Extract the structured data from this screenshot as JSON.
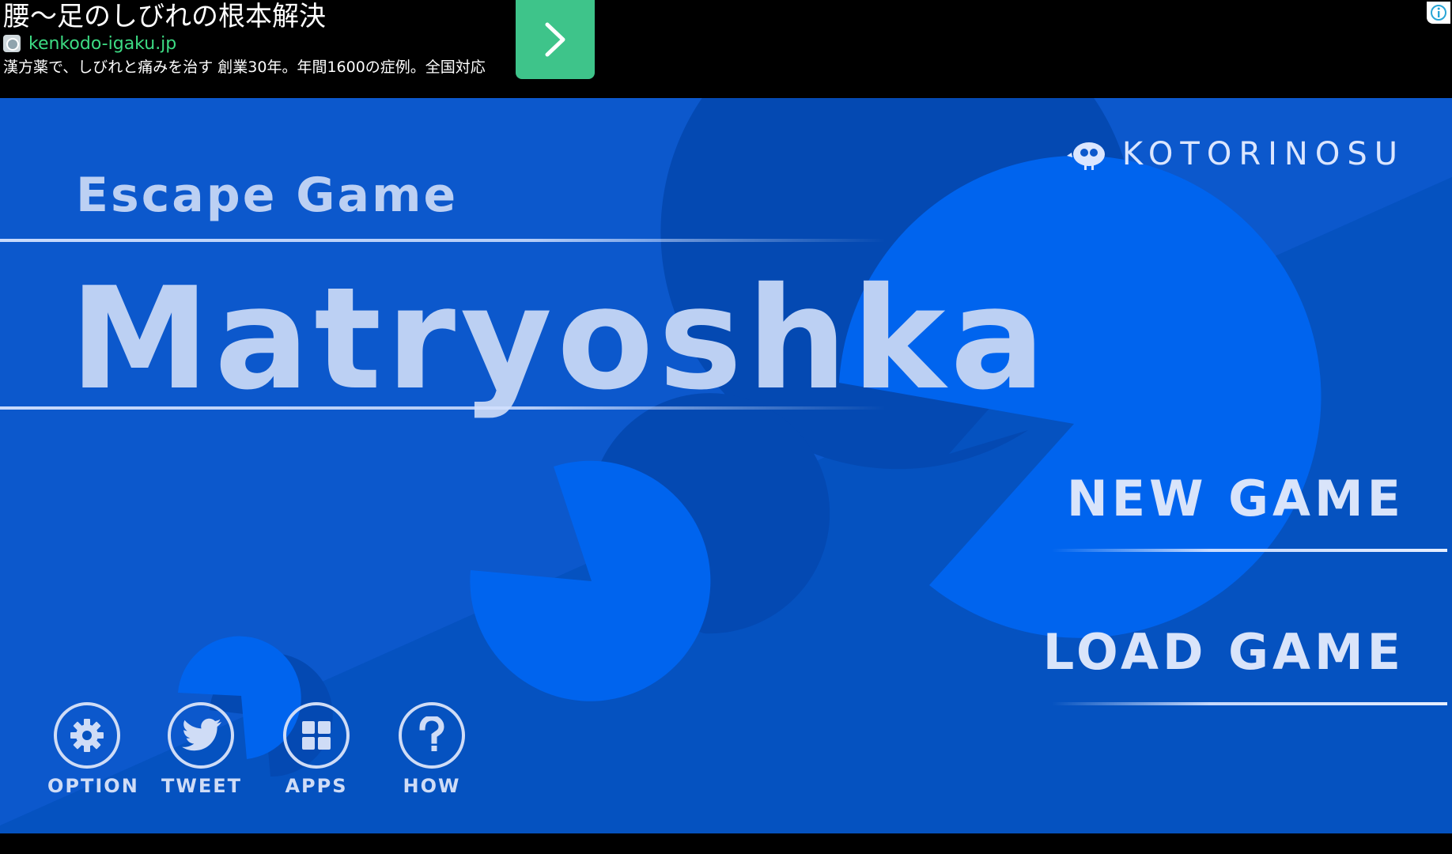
{
  "ad": {
    "title": "腰〜足のしびれの根本解決",
    "url": "kenkodo-igaku.jp",
    "description": "漢方薬で、しびれと痛みを治す 創業30年。年間1600の症例。全国対応",
    "cta_color": "#3ec48a",
    "url_color": "#3ddc84"
  },
  "game": {
    "brand": "KOTORINOSU",
    "subtitle": "Escape Game",
    "title": "Matryoshka",
    "menu": {
      "new_game": "NEW GAME",
      "load_game": "LOAD GAME"
    },
    "buttons": [
      {
        "label": "OPTION",
        "icon": "gear-icon"
      },
      {
        "label": "TWEET",
        "icon": "bird-icon"
      },
      {
        "label": "APPS",
        "icon": "grid-icon"
      },
      {
        "label": "HOW",
        "icon": "question-icon"
      }
    ],
    "colors": {
      "background": "#0a55c8",
      "shape": "#0064ee",
      "shadow": "#0449b2",
      "text": "#bcd0f3"
    }
  }
}
